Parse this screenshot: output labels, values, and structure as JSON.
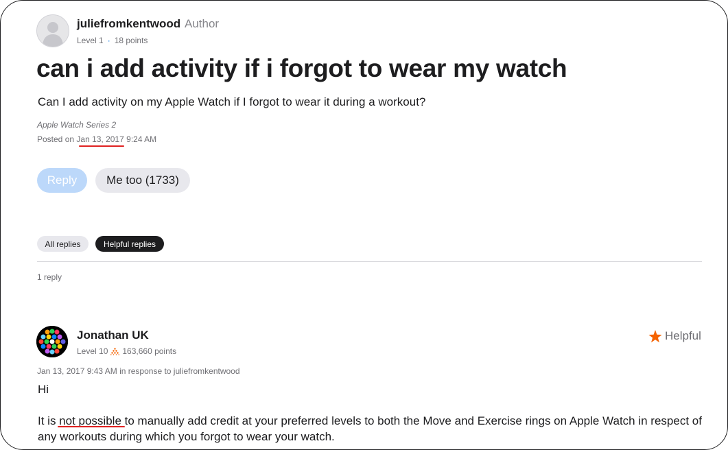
{
  "post": {
    "author": {
      "name": "juliefromkentwood",
      "tag": "Author",
      "level": "Level 1",
      "points": "18 points"
    },
    "title": "can i add activity if i forgot to wear my watch",
    "question": "Can I add activity on my Apple Watch if I forgot to wear it during a workout?",
    "product": "Apple Watch Series 2",
    "posted_prefix": "Posted on",
    "posted_date": "Jan 13, 2017",
    "posted_time": "9:24 AM"
  },
  "actions": {
    "reply_label": "Reply",
    "me_too_label": "Me too (1733)"
  },
  "filters": {
    "all_replies": "All replies",
    "helpful_replies": "Helpful replies",
    "active": "Helpful replies"
  },
  "reply_count": "1 reply",
  "reply": {
    "author": "Jonathan UK",
    "level": "Level 10",
    "points": "163,660 points",
    "helpful_label": "Helpful",
    "meta": "Jan 13, 2017 9:43 AM in response to juliefromkentwood",
    "greeting": "Hi",
    "body_prefix": "It is ",
    "body_emphasis": "not possible",
    "body_suffix": " to manually add credit at your preferred levels to both the Move and Exercise rings on Apple Watch in respect of any workouts during which you forgot to wear your watch."
  },
  "colors": {
    "accent_blue": "#0071e3",
    "reply_disabled": "#bcd8fa",
    "annotation_red": "#e02020",
    "helpful_star": "#f56300"
  },
  "icons": {
    "helpful": "star-icon",
    "level_badge": "pyramid-icon",
    "default_avatar": "person-silhouette-icon",
    "reply_avatar": "app-grid-icon"
  }
}
